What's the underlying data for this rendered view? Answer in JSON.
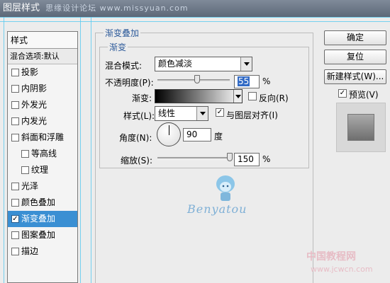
{
  "window": {
    "title": "图层样式",
    "watermark": "思缘设计论坛 www.missyuan.com"
  },
  "left_panel": {
    "header": "样式",
    "blend_options": "混合选项:默认",
    "items": [
      {
        "label": "投影",
        "checked": false
      },
      {
        "label": "内阴影",
        "checked": false
      },
      {
        "label": "外发光",
        "checked": false
      },
      {
        "label": "内发光",
        "checked": false
      },
      {
        "label": "斜面和浮雕",
        "checked": false
      },
      {
        "label": "等高线",
        "checked": false
      },
      {
        "label": "纹理",
        "checked": false
      },
      {
        "label": "光泽",
        "checked": false
      },
      {
        "label": "颜色叠加",
        "checked": false
      },
      {
        "label": "渐变叠加",
        "checked": true,
        "selected": true
      },
      {
        "label": "图案叠加",
        "checked": false
      },
      {
        "label": "描边",
        "checked": false
      }
    ]
  },
  "gradient_overlay": {
    "section_title": "渐变叠加",
    "group_title": "渐变",
    "blend_mode_label": "混合模式:",
    "blend_mode_value": "颜色减淡",
    "opacity_label": "不透明度(P):",
    "opacity_value": "55",
    "opacity_percent": 55,
    "opacity_unit": "%",
    "gradient_label": "渐变:",
    "reverse_label": "反向(R)",
    "reverse_checked": false,
    "style_label": "样式(L):",
    "style_value": "线性",
    "align_label": "与图层对齐(I)",
    "align_checked": true,
    "angle_label": "角度(N):",
    "angle_value": "90",
    "angle_unit": "度",
    "scale_label": "缩放(S):",
    "scale_value": "150",
    "scale_percent": 150,
    "scale_unit": "%",
    "check_mark": "✓"
  },
  "buttons": {
    "ok": "确定",
    "reset": "复位",
    "new_style": "新建样式(W)...",
    "preview_label": "预览(V)",
    "preview_checked": true
  },
  "overlay_marks": {
    "logo_text": "Benyatou",
    "watermark_cn": "中国教程网",
    "watermark_url": "www.jcwcn.com"
  },
  "colors": {
    "selection": "#3a8fd3",
    "group_title": "#2d5a9a",
    "guide_line": "#58c9f0"
  }
}
